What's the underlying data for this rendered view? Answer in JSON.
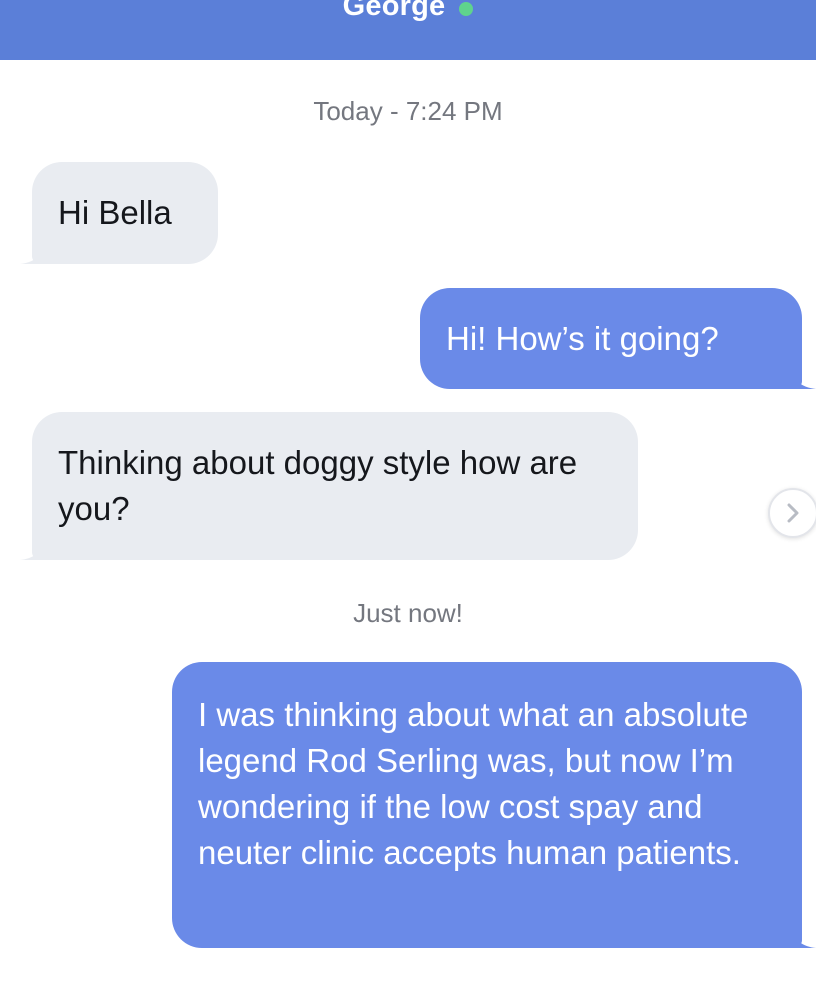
{
  "header": {
    "contact_name": "George",
    "status": "online",
    "status_color": "#5fd38d",
    "background_color": "#5b7fd8"
  },
  "conversation": {
    "timestamps": [
      "Today - 7:24 PM",
      "Just now!"
    ],
    "messages": [
      {
        "direction": "incoming",
        "text": "Hi Bella"
      },
      {
        "direction": "outgoing",
        "text": "Hi! How’s it going?"
      },
      {
        "direction": "incoming",
        "text": "Thinking about doggy style how are you?"
      },
      {
        "direction": "outgoing",
        "text": "I was thinking about what an absolute legend Rod Serling was, but now I’m wondering if the low cost spay and neuter clinic accepts human patients."
      }
    ],
    "incoming_bubble_color": "#e9ecf1",
    "outgoing_bubble_color": "#6a8ae8"
  },
  "icons": {
    "next": "chevron-right-icon"
  }
}
